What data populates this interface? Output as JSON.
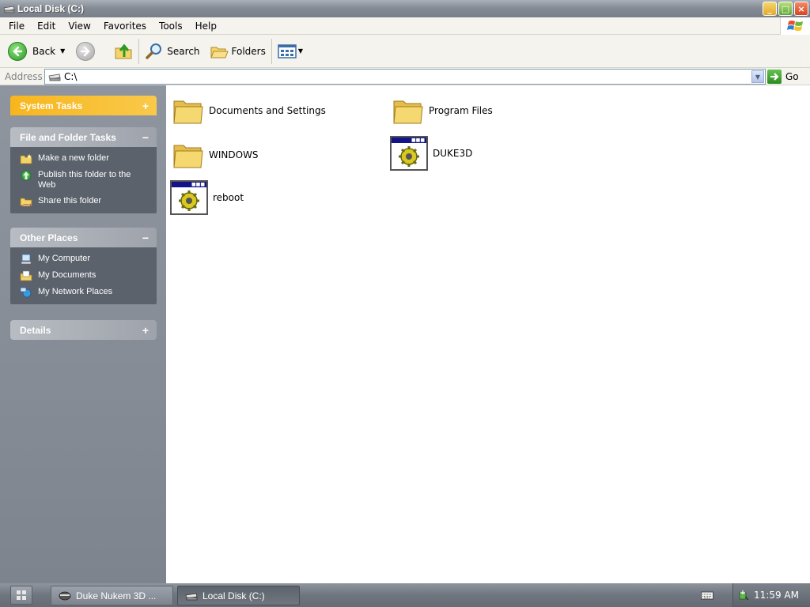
{
  "window": {
    "title": "Local Disk (C:)",
    "controls": {
      "minimize": "_",
      "maximize": "□",
      "close": "×"
    }
  },
  "menubar": {
    "items": [
      "File",
      "Edit",
      "View",
      "Favorites",
      "Tools",
      "Help"
    ]
  },
  "toolbar": {
    "back_label": "Back",
    "search_label": "Search",
    "folders_label": "Folders"
  },
  "address": {
    "label": "Address",
    "value": "C:\\",
    "go_label": "Go"
  },
  "left_pane": {
    "system_tasks": {
      "title": "System Tasks",
      "toggle": "+"
    },
    "file_folder_tasks": {
      "title": "File and Folder Tasks",
      "toggle": "−",
      "items": [
        "Make a new folder",
        "Publish this folder to the Web",
        "Share this folder"
      ]
    },
    "other_places": {
      "title": "Other Places",
      "toggle": "−",
      "items": [
        "My Computer",
        "My Documents",
        "My Network Places"
      ]
    },
    "details": {
      "title": "Details",
      "toggle": "+"
    }
  },
  "files": [
    {
      "name": "Documents and Settings",
      "icon": "folder-icon"
    },
    {
      "name": "Program Files",
      "icon": "folder-icon"
    },
    {
      "name": "WINDOWS",
      "icon": "folder-icon"
    },
    {
      "name": "DUKE3D",
      "icon": "application-icon"
    },
    {
      "name": "reboot",
      "icon": "application-icon"
    }
  ],
  "taskbar": {
    "buttons": [
      {
        "label": "Duke Nukem 3D ...",
        "icon": "duke-icon",
        "active": false
      },
      {
        "label": "Local Disk (C:)",
        "icon": "drive-icon",
        "active": true
      }
    ],
    "clock": "11:59 AM"
  },
  "colors": {
    "panel_body": "#5b626c",
    "panel_header": "#b8bcc3",
    "system_tasks_header": "#f8b61d",
    "folder_yellow": "#f3d46a",
    "app_titlebar": "#14148a"
  }
}
